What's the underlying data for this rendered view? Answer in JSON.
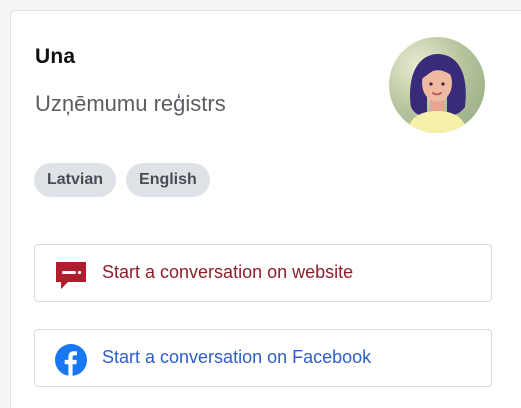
{
  "profile": {
    "name": "Una",
    "organization": "Uzņēmumu reģistrs",
    "avatar_icon": "woman-avatar-icon"
  },
  "languages": [
    "Latvian",
    "English"
  ],
  "actions": {
    "website": {
      "label": "Start a conversation on website",
      "icon": "chat-bubble-icon",
      "color": "#8c1f2a"
    },
    "facebook": {
      "label": "Start a conversation on Facebook",
      "icon": "facebook-icon",
      "color": "#2d5ec9"
    }
  }
}
